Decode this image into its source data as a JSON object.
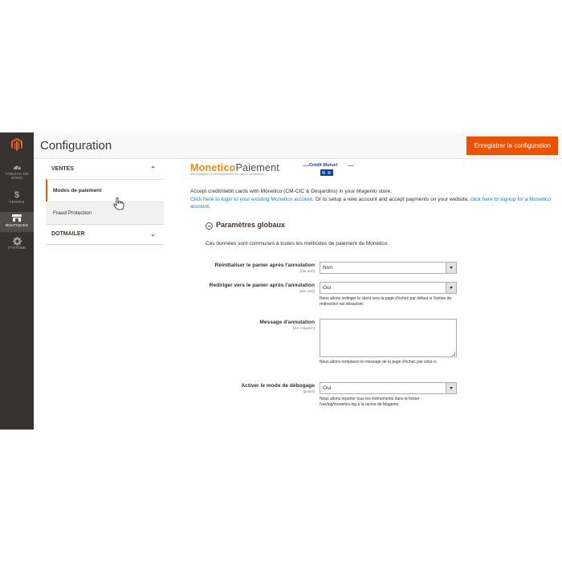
{
  "admin_nav": {
    "items": [
      {
        "icon": "dashboard-icon",
        "label": "TABLEAU DE BORD",
        "active": false
      },
      {
        "icon": "dollar-icon",
        "label": "VENTES",
        "active": false
      },
      {
        "icon": "store-icon",
        "label": "BOUTIQUES",
        "active": true
      },
      {
        "icon": "gear-icon",
        "label": "SYSTÈME",
        "active": false
      }
    ]
  },
  "header": {
    "title": "Configuration",
    "save_label": "Enregistrer la configuration",
    "accent_color": "#eb5202"
  },
  "config_tabs": {
    "groups": [
      {
        "label": "VENTES",
        "expanded": true,
        "items": [
          {
            "label": "Modes de paiement",
            "active": true
          },
          {
            "label": "Fraud Protection",
            "active": false
          }
        ]
      },
      {
        "label": "DOTMAILER",
        "expanded": false,
        "items": []
      }
    ]
  },
  "main": {
    "brand_first": "M",
    "brand_mid": "onetico",
    "brand_last": "Paiement",
    "brand_tagline": "Accompagner le développement de votre e-commerce",
    "partner_logo": "Crédit Mutuel",
    "intro": "Accept credit/debit cards with Monetico (CM-CIC & Desjardins) in your Magento store.",
    "link_login": "Click here to login to your existing Monetico account",
    "links_middle": ". Or to setup a new account and accept payments on your website, ",
    "link_signup": "click here to signup for a Monetico account",
    "links_end": ".",
    "section_title": "Paramètres globaux",
    "section_desc": "Ces données sont communes à toutes les méthodes de paiement de Monetico.",
    "fields": [
      {
        "label": "Réinitialiser le panier après l'annulation",
        "scope": "[site web]",
        "value": "Non",
        "note": ""
      },
      {
        "label": "Rediriger vers le panier après l'annulation",
        "scope": "[site web]",
        "value": "Oui",
        "note": "Nous allons rediriger le client vers la page d'échec par défaut si l'option de redirection est désactivé."
      },
      {
        "label": "Message d'annulation",
        "scope": "[vue magasin]",
        "value": "",
        "note": "Nous allons remplacer le message de la page d'échec par celui-ci."
      },
      {
        "label": "Activer le mode de débogage",
        "scope": "[global]",
        "value": "Oui",
        "note": "Nous allons reporter tous les événements dans le fichier /var/log/monetico.log à la racine de Magento."
      }
    ]
  }
}
